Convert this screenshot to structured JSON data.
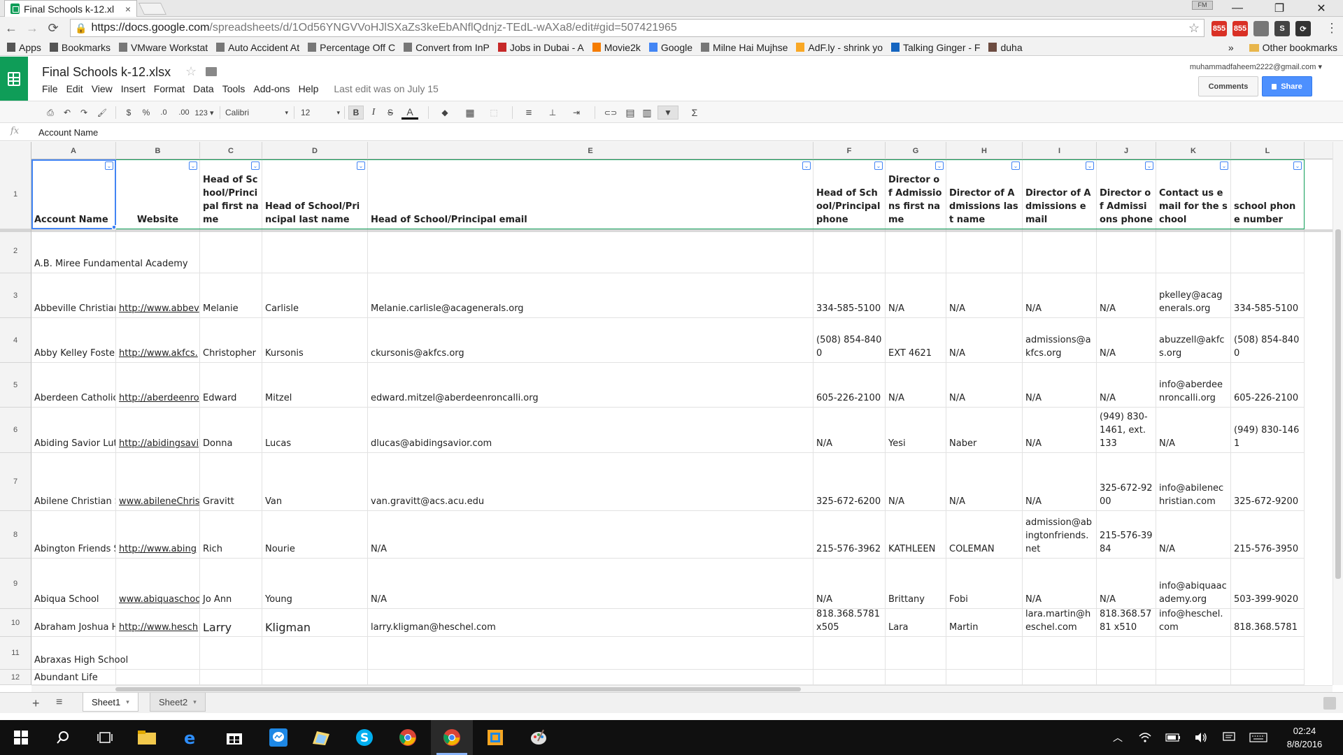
{
  "browser": {
    "tab_title": "Final Schools k-12.xl",
    "tab_close": "×",
    "profile": "FM",
    "window_controls": {
      "minimize": "—",
      "restore": "❐",
      "close": "✕"
    },
    "url_host": "https://docs.google.com",
    "url_path": "/spreadsheets/d/1Od56YNGVVoHJlSXaZs3keEbANflQdnjz-TEdL-wAXa8/edit#gid=507421965",
    "extensions": [
      {
        "label": "855",
        "color": "#d93025"
      },
      {
        "label": "855",
        "color": "#d93025"
      },
      {
        "label": "",
        "color": "#777777"
      },
      {
        "label": "S",
        "color": "#444444"
      },
      {
        "label": "⟳",
        "color": "#333333"
      }
    ],
    "menu_icon": "⋮",
    "bookmarks": [
      {
        "label": "Apps",
        "icon_color": "#555555"
      },
      {
        "label": "Bookmarks",
        "icon_color": "#555555"
      },
      {
        "label": "VMware Workstat",
        "icon_color": "#777777"
      },
      {
        "label": "Auto Accident At",
        "icon_color": "#777777"
      },
      {
        "label": "Percentage Off C",
        "icon_color": "#777777"
      },
      {
        "label": "Convert from InP",
        "icon_color": "#777777"
      },
      {
        "label": "Jobs in Dubai - A",
        "icon_color": "#c62828"
      },
      {
        "label": "Movie2k",
        "icon_color": "#f57c00"
      },
      {
        "label": "Google",
        "icon_color": "#4285f4"
      },
      {
        "label": "Milne Hai Mujhse",
        "icon_color": "#777777"
      },
      {
        "label": "AdF.ly - shrink yo",
        "icon_color": "#f9a825"
      },
      {
        "label": "Talking Ginger - F",
        "icon_color": "#1565c0"
      },
      {
        "label": "duha",
        "icon_color": "#6d4c41"
      }
    ],
    "bookmarks_overflow": "»",
    "other_bookmarks": "Other bookmarks"
  },
  "sheets": {
    "doc_title": "Final Schools k-12.xlsx",
    "star": "☆",
    "menus": [
      "File",
      "Edit",
      "View",
      "Insert",
      "Format",
      "Data",
      "Tools",
      "Add-ons",
      "Help"
    ],
    "last_edit": "Last edit was on July 15",
    "account": "muhammadfaheem2222@gmail.com ▾",
    "comments_label": "Comments",
    "share_label": "Share",
    "toolbar": {
      "print": "⎙",
      "undo": "↶",
      "redo": "↷",
      "paint": "🖌",
      "currency": "$",
      "percent": "%",
      "dec_less": ".0",
      "dec_more": ".00",
      "more_formats": "123 ▾",
      "font": "Calibri",
      "font_caret": "▾",
      "size": "12",
      "size_caret": "▾",
      "bold": "B",
      "italic": "I",
      "strike": "S",
      "text_color": "A",
      "fill": "◆",
      "borders": "▦",
      "merge": "⬚",
      "align": "≡",
      "valign": "⊥",
      "wrap": "⇥",
      "link": "⊂⊃",
      "comment": "▤",
      "chart": "▥",
      "filter": "▼",
      "functions": "Σ"
    },
    "formula_label": "fx",
    "formula_value": "Account Name",
    "columns": [
      "A",
      "B",
      "C",
      "D",
      "E",
      "F",
      "G",
      "H",
      "I",
      "J",
      "K",
      "L"
    ],
    "row_numbers": [
      "1",
      "2",
      "3",
      "4",
      "5",
      "6",
      "7",
      "8",
      "9",
      "10",
      "11",
      "12"
    ],
    "headers": [
      "Account Name",
      "Website",
      "Head of School/Principal first name",
      "Head of School/Principal last name",
      "Head of School/Principal email",
      "Head of School/Principal phone",
      "Director of Admissions first name",
      "Director of Admissions last name",
      "Director of Admissions email",
      "Director of Admissions phone",
      "Contact us email for the school",
      "school phone number"
    ],
    "filter_glyph": "⌄",
    "rows": [
      [
        "A.B. Miree Fundamental Academy",
        "",
        "",
        "",
        "",
        "",
        "",
        "",
        "",
        "",
        "",
        ""
      ],
      [
        "Abbeville Christian",
        "http://www.abbev",
        "Melanie",
        "Carlisle",
        "Melanie.carlisle@acagenerals.org",
        "334-585-5100",
        "N/A",
        "N/A",
        "N/A",
        "N/A",
        "pkelley@acagenerals.org",
        "334-585-5100"
      ],
      [
        "Abby Kelley Foster",
        "http://www.akfcs.",
        "Christopher",
        "Kursonis",
        "ckursonis@akfcs.org",
        "(508) 854-8400",
        "EXT 4621",
        "N/A",
        "admissions@akfcs.org",
        "N/A",
        "abuzzell@akfcs.org",
        "(508) 854-8400"
      ],
      [
        "Aberdeen Catholic",
        "http://aberdeenro",
        "Edward",
        "Mitzel",
        "edward.mitzel@aberdeenroncalli.org",
        "605-226-2100",
        "N/A",
        "N/A",
        "N/A",
        "N/A",
        "info@aberdeenroncalli.org",
        "605-226-2100"
      ],
      [
        "Abiding Savior Lut",
        "http://abidingsavi",
        "Donna",
        "Lucas",
        "dlucas@abidingsavior.com",
        "N/A",
        "Yesi",
        "Naber",
        "N/A",
        "(949) 830-1461, ext. 133",
        "N/A",
        "(949) 830-1461"
      ],
      [
        "Abilene Christian S",
        "www.abileneChris",
        "Gravitt",
        "Van",
        "van.gravitt@acs.acu.edu",
        "325-672-6200",
        "N/A",
        "N/A",
        "N/A",
        "325-672-9200",
        "info@abilenechristian.com",
        "325-672-9200"
      ],
      [
        "Abington Friends S",
        "http://www.abing",
        "Rich",
        "Nourie",
        "N/A",
        "215-576-3962",
        "KATHLEEN",
        "COLEMAN",
        "admission@abingtonfriends.net",
        "215-576-3984",
        "N/A",
        "215-576-3950"
      ],
      [
        "Abiqua School",
        "www.abiquaschoo",
        "Jo Ann",
        "Young",
        "N/A",
        "N/A",
        "Brittany",
        "Fobi",
        "N/A",
        "N/A",
        "info@abiquaacademy.org",
        "503-399-9020"
      ],
      [
        "Abraham Joshua H",
        "http://www.hesch",
        "Larry",
        "Kligman",
        "larry.kligman@heschel.com",
        "818.368.5781 x505",
        "Lara",
        "Martin",
        "lara.martin@heschel.com",
        "818.368.5781 x510",
        "info@heschel.com",
        "818.368.5781"
      ],
      [
        "Abraxas High School",
        "",
        "",
        "",
        "",
        "",
        "",
        "",
        "",
        "",
        "",
        ""
      ],
      [
        "Abundant Life",
        "",
        "",
        "",
        "",
        "",
        "",
        "",
        "",
        "",
        "",
        ""
      ]
    ],
    "sheet_tabs": [
      {
        "label": "Sheet1",
        "active": true
      },
      {
        "label": "Sheet2",
        "active": false
      }
    ],
    "add_sheet": "+",
    "sheet_list": "≡"
  },
  "taskbar": {
    "clock_time": "02:24",
    "clock_date": "8/8/2016",
    "tray_caret": "︿"
  }
}
